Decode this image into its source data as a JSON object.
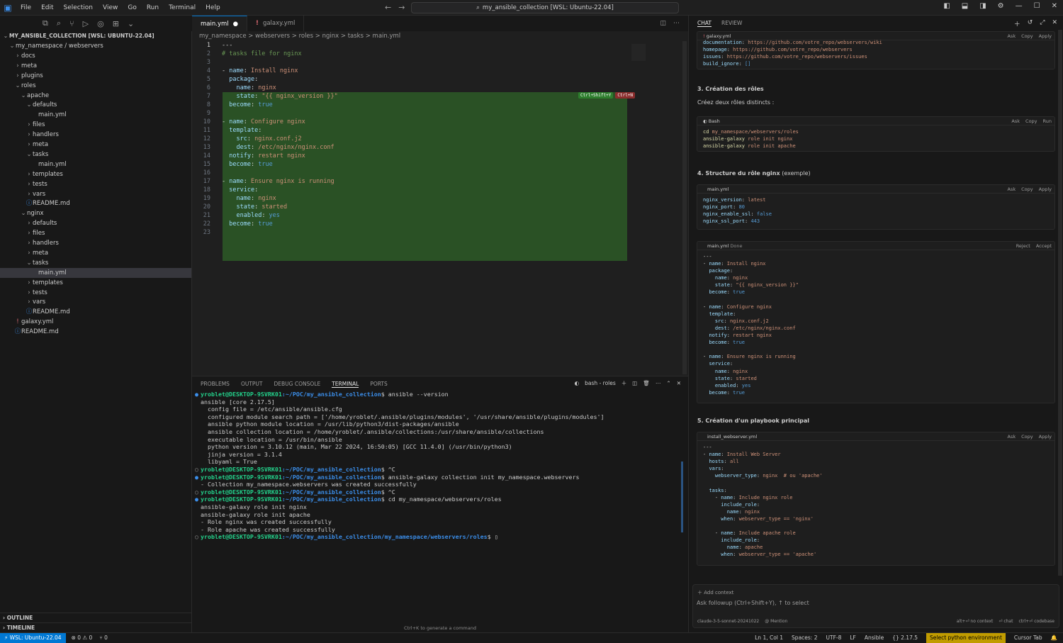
{
  "titlebar": {
    "menu": [
      "File",
      "Edit",
      "Selection",
      "View",
      "Go",
      "Run",
      "Terminal",
      "Help"
    ],
    "search": "my_ansible_collection [WSL: Ubuntu-22.04]"
  },
  "explorer": {
    "root": "MY_ANSIBLE_COLLECTION [WSL: UBUNTU-22.04]",
    "items": [
      {
        "label": "my_namespace / webservers",
        "depth": 1,
        "chev": "v"
      },
      {
        "label": "docs",
        "depth": 2,
        "chev": ">"
      },
      {
        "label": "meta",
        "depth": 2,
        "chev": ">"
      },
      {
        "label": "plugins",
        "depth": 2,
        "chev": ">"
      },
      {
        "label": "roles",
        "depth": 2,
        "chev": "v"
      },
      {
        "label": "apache",
        "depth": 3,
        "chev": "v"
      },
      {
        "label": "defaults",
        "depth": 4,
        "chev": "v"
      },
      {
        "label": "main.yml",
        "depth": 5,
        "chev": ""
      },
      {
        "label": "files",
        "depth": 4,
        "chev": ">"
      },
      {
        "label": "handlers",
        "depth": 4,
        "chev": ">"
      },
      {
        "label": "meta",
        "depth": 4,
        "chev": ">"
      },
      {
        "label": "tasks",
        "depth": 4,
        "chev": "v"
      },
      {
        "label": "main.yml",
        "depth": 5,
        "chev": ""
      },
      {
        "label": "templates",
        "depth": 4,
        "chev": ">"
      },
      {
        "label": "tests",
        "depth": 4,
        "chev": ">"
      },
      {
        "label": "vars",
        "depth": 4,
        "chev": ">"
      },
      {
        "label": "README.md",
        "depth": 4,
        "chev": "i"
      },
      {
        "label": "nginx",
        "depth": 3,
        "chev": "v"
      },
      {
        "label": "defaults",
        "depth": 4,
        "chev": ">"
      },
      {
        "label": "files",
        "depth": 4,
        "chev": ">"
      },
      {
        "label": "handlers",
        "depth": 4,
        "chev": ">"
      },
      {
        "label": "meta",
        "depth": 4,
        "chev": ">"
      },
      {
        "label": "tasks",
        "depth": 4,
        "chev": "v"
      },
      {
        "label": "main.yml",
        "depth": 5,
        "chev": "",
        "selected": true
      },
      {
        "label": "templates",
        "depth": 4,
        "chev": ">"
      },
      {
        "label": "tests",
        "depth": 4,
        "chev": ">"
      },
      {
        "label": "vars",
        "depth": 4,
        "chev": ">"
      },
      {
        "label": "README.md",
        "depth": 4,
        "chev": "i"
      },
      {
        "label": "galaxy.yml",
        "depth": 2,
        "chev": "!"
      },
      {
        "label": "README.md",
        "depth": 2,
        "chev": "i"
      }
    ],
    "outline": "OUTLINE",
    "timeline": "TIMELINE"
  },
  "editor": {
    "tabs": [
      {
        "label": "main.yml",
        "modified": "●"
      },
      {
        "label": "galaxy.yml",
        "modified": ""
      }
    ],
    "breadcrumb": "my_namespace  >  webservers  >  roles  >  nginx  >  tasks  >        main.yml",
    "accept_label": "Ctrl+Shift+Y",
    "reject_label": "Ctrl+N",
    "lines": [
      "---",
      "# tasks file for nginx",
      "",
      "- name: Install nginx",
      "  package:",
      "    name: nginx",
      "    state: \"{{ nginx_version }}\"",
      "  become: true",
      "",
      "- name: Configure nginx",
      "  template:",
      "    src: nginx.conf.j2",
      "    dest: /etc/nginx/nginx.conf",
      "  notify: restart nginx",
      "  become: true",
      "",
      "- name: Ensure nginx is running",
      "  service:",
      "    name: nginx",
      "    state: started",
      "    enabled: yes",
      "  become: true",
      ""
    ]
  },
  "panel": {
    "tabs": [
      "PROBLEMS",
      "OUTPUT",
      "DEBUG CONSOLE",
      "TERMINAL",
      "PORTS"
    ],
    "active_tab": "TERMINAL",
    "terminal_name": "bash - roles",
    "hint": "Ctrl+K to generate a command",
    "lines": [
      {
        "dot": "●",
        "prompt": "yroblet@DESKTOP-9SVRK01",
        "path": ":~/POC/my_ansible_collection",
        "cmd": "$ ansible --version"
      },
      {
        "text": "ansible [core 2.17.5]"
      },
      {
        "text": "  config file = /etc/ansible/ansible.cfg"
      },
      {
        "text": "  configured module search path = ['/home/yroblet/.ansible/plugins/modules', '/usr/share/ansible/plugins/modules']"
      },
      {
        "text": "  ansible python module location = /usr/lib/python3/dist-packages/ansible"
      },
      {
        "text": "  ansible collection location = /home/yroblet/.ansible/collections:/usr/share/ansible/collections"
      },
      {
        "text": "  executable location = /usr/bin/ansible"
      },
      {
        "text": "  python version = 3.10.12 (main, Mar 22 2024, 16:50:05) [GCC 11.4.0] (/usr/bin/python3)"
      },
      {
        "text": "  jinja version = 3.1.4"
      },
      {
        "text": "  libyaml = True"
      },
      {
        "dot": "○",
        "prompt": "yroblet@DESKTOP-9SVRK01",
        "path": ":~/POC/my_ansible_collection",
        "cmd": "$ ^C"
      },
      {
        "dot": "●",
        "prompt": "yroblet@DESKTOP-9SVRK01",
        "path": ":~/POC/my_ansible_collection",
        "cmd": "$ ansible-galaxy collection init my_namespace.webservers"
      },
      {
        "text": "- Collection my_namespace.webservers was created successfully"
      },
      {
        "dot": "○",
        "prompt": "yroblet@DESKTOP-9SVRK01",
        "path": ":~/POC/my_ansible_collection",
        "cmd": "$ ^C"
      },
      {
        "dot": "●",
        "prompt": "yroblet@DESKTOP-9SVRK01",
        "path": ":~/POC/my_ansible_collection",
        "cmd": "$ cd my_namespace/webservers/roles"
      },
      {
        "text": "ansible-galaxy role init nginx"
      },
      {
        "text": "ansible-galaxy role init apache"
      },
      {
        "text": "- Role nginx was created successfully"
      },
      {
        "text": "- Role apache was created successfully"
      },
      {
        "dot": "○",
        "prompt": "yroblet@DESKTOP-9SVRK01",
        "path": ":~/POC/my_ansible_collection/my_namespace/webservers/roles",
        "cmd": "$ ▯"
      }
    ]
  },
  "chat": {
    "tabs": [
      "CHAT",
      "REVIEW"
    ],
    "block1": {
      "file": "galaxy.yml",
      "lines": [
        "documentation: https://github.com/votre_repo/webservers/wiki",
        "homepage: https://github.com/votre_repo/webservers",
        "issues: https://github.com/votre_repo/webservers/issues",
        "build_ignore: []"
      ]
    },
    "h3": "3. Création des rôles",
    "p3": "Créez deux rôles distincts :",
    "block2": {
      "file": "Bash",
      "lines": [
        "cd my_namespace/webservers/roles",
        "ansible-galaxy role init nginx",
        "ansible-galaxy role init apache"
      ]
    },
    "h4": "4. Structure du rôle nginx",
    "h4b": "(exemple)",
    "block3": {
      "file": "main.yml",
      "lines": [
        "nginx_version: latest",
        "nginx_port: 80",
        "nginx_enable_ssl: false",
        "nginx_ssl_port: 443"
      ]
    },
    "block4": {
      "file": "main.yml",
      "status": "Done",
      "reject": "Reject",
      "accept": "Accept",
      "lines": [
        "---",
        "- name: Install nginx",
        "  package:",
        "    name: nginx",
        "    state: \"{{ nginx_version }}\"",
        "  become: true",
        "",
        "- name: Configure nginx",
        "  template:",
        "    src: nginx.conf.j2",
        "    dest: /etc/nginx/nginx.conf",
        "  notify: restart nginx",
        "  become: true",
        "",
        "- name: Ensure nginx is running",
        "  service:",
        "    name: nginx",
        "    state: started",
        "    enabled: yes",
        "  become: true"
      ]
    },
    "h5": "5. Création d'un playbook principal",
    "block5": {
      "file": "install_webserver.yml",
      "lines": [
        "---",
        "- name: Install Web Server",
        "  hosts: all",
        "  vars:",
        "    webserver_type: nginx  # ou 'apache'",
        "",
        "  tasks:",
        "    - name: Include nginx role",
        "      include_role:",
        "        name: nginx",
        "      when: webserver_type == 'nginx'",
        "",
        "    - name: Include apache role",
        "      include_role:",
        "        name: apache",
        "      when: webserver_type == 'apache'"
      ]
    },
    "actions": {
      "ask": "Ask",
      "copy": "Copy",
      "apply": "Apply",
      "run": "Run"
    },
    "add_context": "Add context",
    "followup_placeholder": "Ask followup (Ctrl+Shift+Y), ↑ to select",
    "model": "claude-3-5-sonnet-20241022",
    "mention": "@ Mention",
    "hint_noctx": "alt+⏎ no context",
    "hint_chat": "⏎ chat",
    "hint_codebase": "ctrl+⏎ codebase"
  },
  "statusbar": {
    "remote": "WSL: Ubuntu-22.04",
    "problems": "⊗ 0 ⚠ 0",
    "ports": "⑂ 0",
    "position": "Ln 1, Col 1",
    "spaces": "Spaces: 2",
    "encoding": "UTF-8",
    "eol": "LF",
    "language": "Ansible",
    "version": "{} 2.17.5",
    "pyenv": "Select python environment",
    "cursor": "Cursor Tab"
  }
}
